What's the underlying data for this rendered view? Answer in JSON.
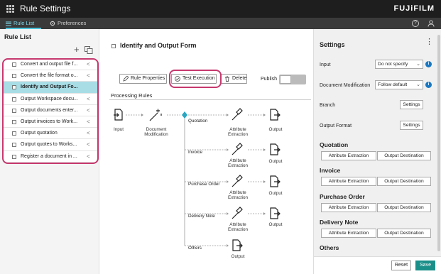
{
  "app": {
    "title": "Rule Settings",
    "brand": "FUJiFILM"
  },
  "tabs": {
    "rule_list": "Rule List",
    "preferences": "Preferences"
  },
  "sidebar": {
    "title": "Rule List",
    "items": [
      {
        "label": "Convert and output file f..."
      },
      {
        "label": "Convert the file format o..."
      },
      {
        "label": "Identify and Output Fo..."
      },
      {
        "label": "Output Workspace docu..."
      },
      {
        "label": "Output documents enter..."
      },
      {
        "label": "Output invoices to Work..."
      },
      {
        "label": "Output quotation"
      },
      {
        "label": "Output quotes to Works..."
      },
      {
        "label": "Register a document in ..."
      }
    ]
  },
  "main": {
    "title": "Identify and Output Form",
    "toolbar": {
      "rule_properties": "Rule Properties",
      "test_execution": "Test Execution",
      "delete": "Delete",
      "publish": "Publish"
    },
    "processing_rules": "Processing Rules",
    "flow": {
      "input": "Input",
      "doc_mod": "Document Modification",
      "attr_extraction": "Attribute Extraction",
      "output": "Output",
      "branches": [
        "Quotation",
        "Invoice",
        "Purchase Order",
        "Delivery Note",
        "Others"
      ]
    }
  },
  "settings": {
    "title": "Settings",
    "input_label": "Input",
    "input_value": "Do not specify",
    "doc_mod_label": "Document Modification",
    "doc_mod_value": "Follow default",
    "branch_label": "Branch",
    "output_format_label": "Output Format",
    "settings_btn": "Settings",
    "attr_btn": "Attribute Extraction",
    "dest_btn": "Output Destination",
    "sections": [
      "Quotation",
      "Invoice",
      "Purchase Order",
      "Delivery Note",
      "Others"
    ],
    "reset": "Reset",
    "save": "Save"
  },
  "colors": {
    "accent": "#4cc3db",
    "highlight": "#c7386e",
    "save": "#1a8f8a",
    "info": "#1a78c2",
    "selected_row": "#a8dde6"
  }
}
